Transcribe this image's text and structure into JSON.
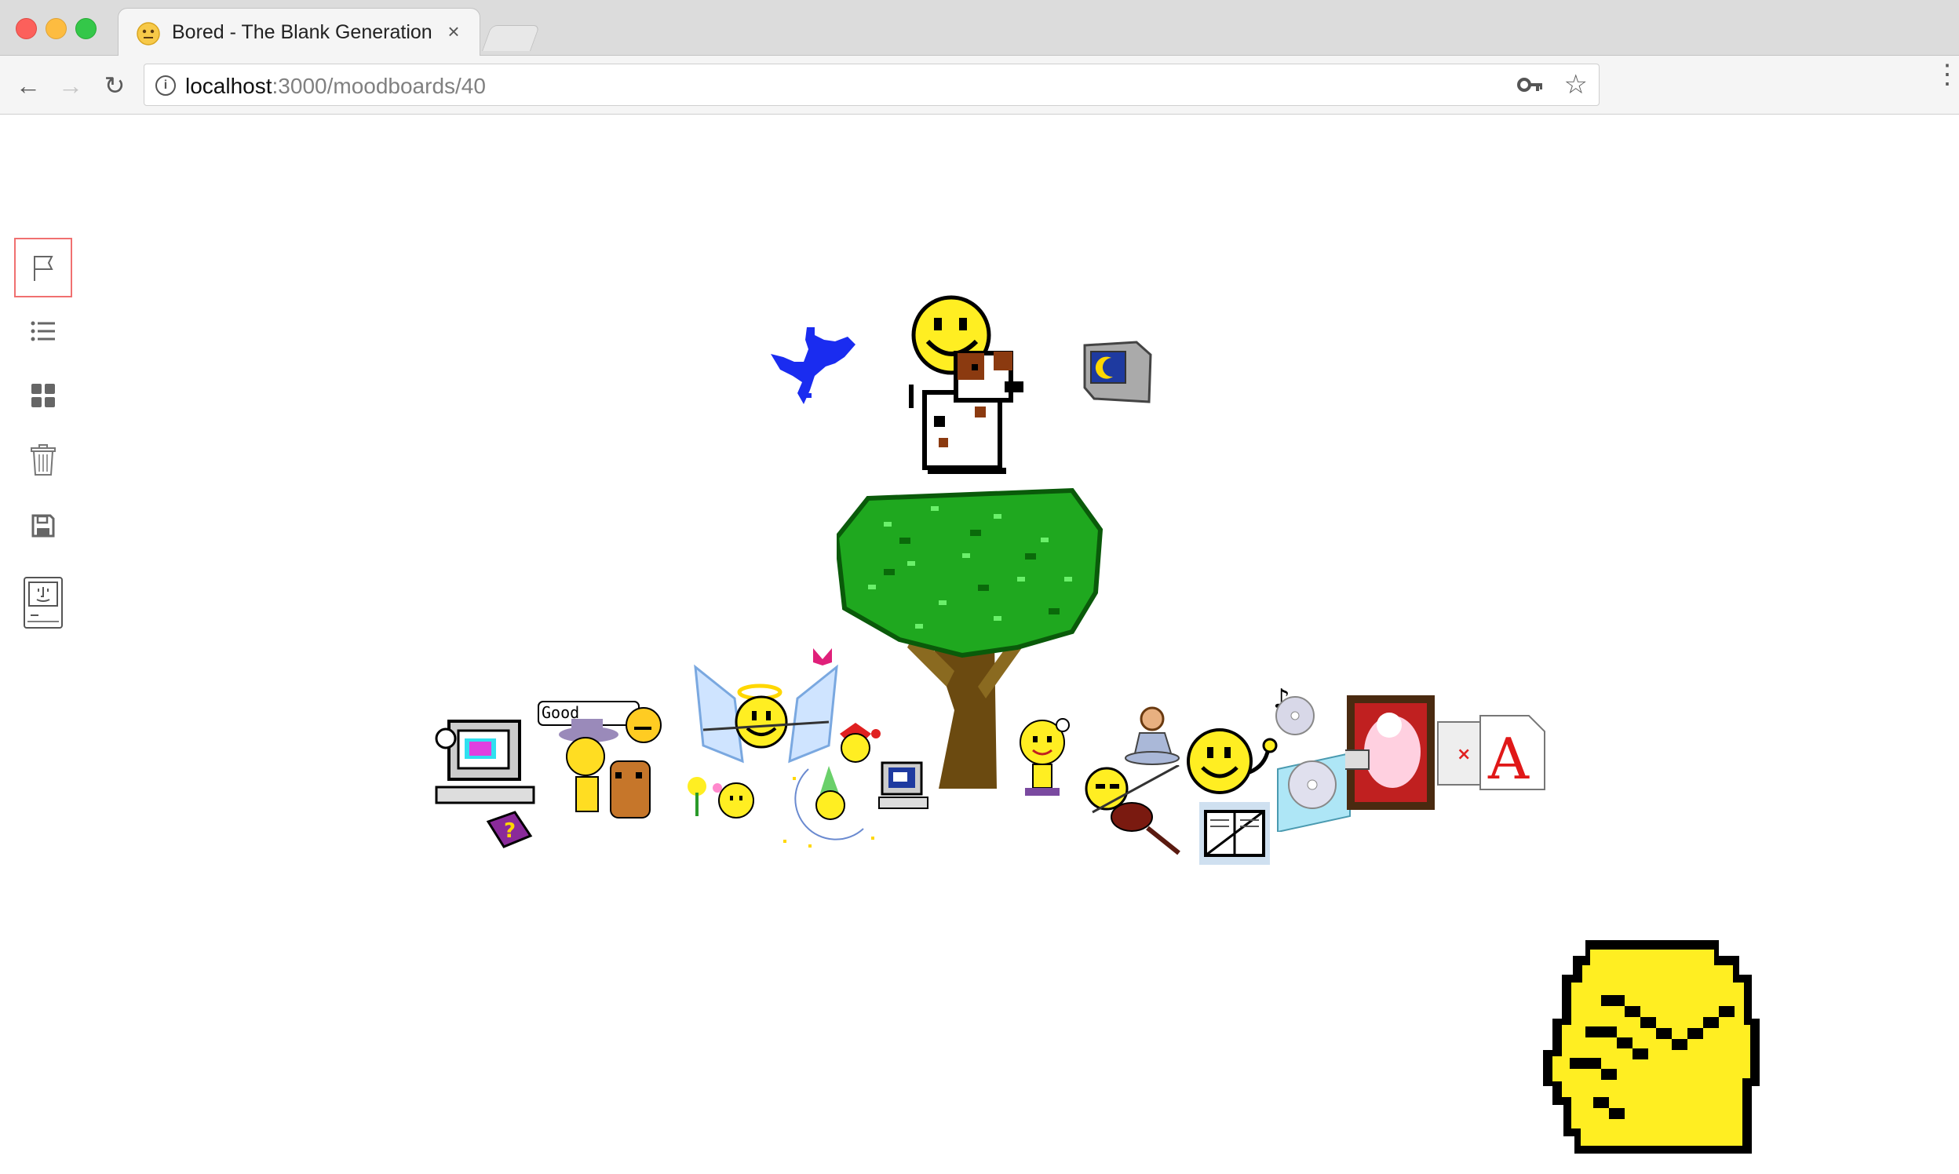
{
  "window": {
    "tab_title": "Bored - The Blank Generation",
    "tab_close": "×"
  },
  "toolbar": {
    "url_host": "localhost",
    "url_rest": ":3000/moodboards/40",
    "back_glyph": "←",
    "forward_glyph": "→",
    "reload_glyph": "↻",
    "star_glyph": "☆",
    "menu_glyph": "⋮",
    "info_glyph": "i"
  },
  "sidebar": {
    "items": [
      {
        "name": "flag",
        "icon": "flag-icon",
        "active": true
      },
      {
        "name": "list",
        "icon": "list-icon",
        "active": false
      },
      {
        "name": "grid",
        "icon": "grid-icon",
        "active": false
      },
      {
        "name": "trash",
        "icon": "trash-icon",
        "active": false
      },
      {
        "name": "save",
        "icon": "save-icon",
        "active": false
      },
      {
        "name": "computer",
        "icon": "mac-computer-icon",
        "active": false
      }
    ]
  },
  "canvas": {
    "speech_bubble_text": "Good",
    "colors": {
      "smiley_yellow": "#ffee22",
      "tree_green": "#1fa81f",
      "bird_blue": "#1a2cf0",
      "trunk_brown": "#5a3a10"
    }
  }
}
